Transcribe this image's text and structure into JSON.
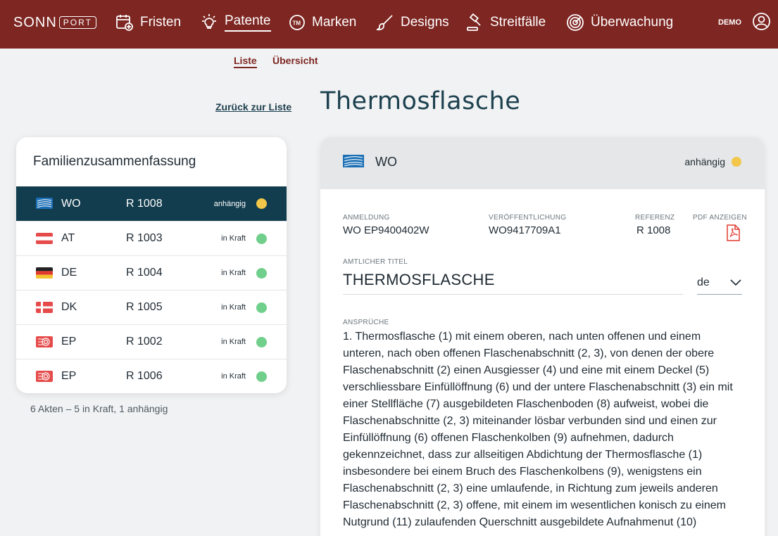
{
  "app": {
    "logo_main": "SONN",
    "logo_sub": "PORT",
    "user_label": "DEMO"
  },
  "nav": {
    "items": [
      {
        "label": "Fristen",
        "icon": "calendar-icon"
      },
      {
        "label": "Patente",
        "icon": "lightbulb-icon",
        "active": true
      },
      {
        "label": "Marken",
        "icon": "trademark-icon"
      },
      {
        "label": "Designs",
        "icon": "brush-icon"
      },
      {
        "label": "Streitfälle",
        "icon": "gavel-icon"
      },
      {
        "label": "Überwachung",
        "icon": "radar-icon"
      }
    ]
  },
  "subnav": {
    "tabs": [
      {
        "label": "Liste",
        "active": true
      },
      {
        "label": "Übersicht",
        "active": false
      }
    ]
  },
  "page": {
    "back_link": "Zurück zur Liste",
    "title": "Thermosflasche"
  },
  "family": {
    "title": "Familienzusammenfassung",
    "rows": [
      {
        "country": "WO",
        "reference": "R 1008",
        "status": "anhängig",
        "status_color": "#f3c74a",
        "active": true
      },
      {
        "country": "AT",
        "reference": "R 1003",
        "status": "in Kraft",
        "status_color": "#6fcf8b"
      },
      {
        "country": "DE",
        "reference": "R 1004",
        "status": "in Kraft",
        "status_color": "#6fcf8b"
      },
      {
        "country": "DK",
        "reference": "R 1005",
        "status": "in Kraft",
        "status_color": "#6fcf8b"
      },
      {
        "country": "EP",
        "reference": "R 1002",
        "status": "in Kraft",
        "status_color": "#6fcf8b"
      },
      {
        "country": "EP",
        "reference": "R 1006",
        "status": "in Kraft",
        "status_color": "#6fcf8b"
      }
    ],
    "summary": "6 Akten – 5 in Kraft, 1 anhängig"
  },
  "detail": {
    "country": "WO",
    "status": "anhängig",
    "status_color": "#f3c74a",
    "application_label": "ANMELDUNG",
    "application_value": "WO EP9400402W",
    "publication_label": "VERÖFFENTLICHUNG",
    "publication_value": "WO9417709A1",
    "reference_label": "REFERENZ",
    "reference_value": "R 1008",
    "pdf_label": "PDF ANZEIGEN",
    "official_title_label": "AMTLICHER TITEL",
    "official_title": "THERMOSFLASCHE",
    "language": "de",
    "claims_label": "ANSPRÜCHE",
    "claims_text": "1. Thermosflasche (1) mit einem oberen, nach unten offenen und einem unteren, nach oben offenen Flaschenabschnitt (2, 3), von denen der obere Flaschenabschnitt (2) einen Ausgiesser (4) und eine mit einem Deckel (5) verschliessbare Einfüllöffnung (6) und der untere Flaschenabschnitt (3) ein mit einer Stellfläche (7) ausgebildeten Flaschenboden (8) aufweist, wobei die Flaschenabschnitte (2, 3) miteinander lösbar verbunden sind und einen zur Einfüllöffnung (6) offenen Flaschenkolben (9) aufnehmen, dadurch gekennzeichnet, dass zur allseitigen Abdichtung der Thermosflasche (1) insbesondere bei einem Bruch des Flaschenkolbens (9), wenigstens ein Flaschenabschnitt (2, 3) eine umlaufende, in Richtung zum jeweils anderen Flaschenabschnitt (2, 3) offene, mit einem im wesentlichen konisch zu einem Nutgrund (11) zulaufenden Querschnitt ausgebildete Aufnahmenut (10)"
  },
  "colors": {
    "brand": "#7d2622",
    "active_row": "#123d4e",
    "status_pending": "#f3c74a",
    "status_active": "#6fcf8b"
  }
}
